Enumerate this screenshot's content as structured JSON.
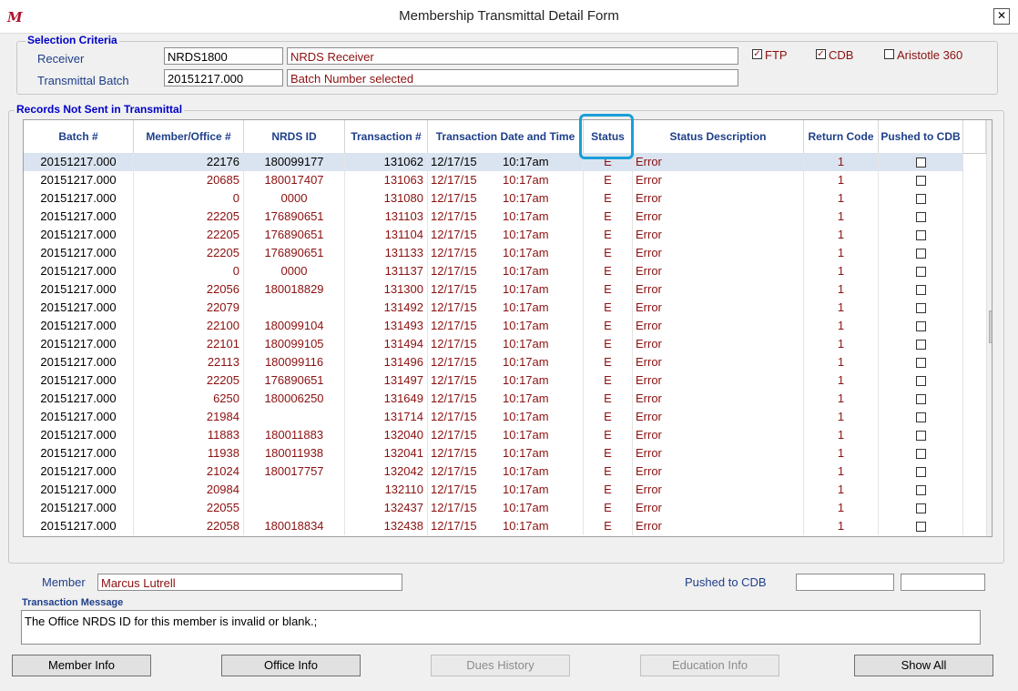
{
  "window": {
    "title": "Membership Transmittal Detail Form",
    "close_label": "✕"
  },
  "selection": {
    "label": "Selection Criteria",
    "receiver_label": "Receiver",
    "receiver_code": "NRDS1800",
    "receiver_name": "NRDS Receiver",
    "batch_label": "Transmittal Batch",
    "batch_value": "20151217.000",
    "batch_desc": "Batch Number selected",
    "ftp_label": "FTP",
    "ftp_checked": true,
    "cdb_label": "CDB",
    "cdb_checked": true,
    "aristotle_label": "Aristotle 360",
    "aristotle_checked": false
  },
  "records": {
    "label": "Records Not Sent in Transmittal",
    "columns": [
      "Batch #",
      "Member/Office #",
      "NRDS ID",
      "Transaction #",
      "Transaction Date and Time",
      "Status",
      "Status Description",
      "Return Code",
      "Pushed to CDB"
    ],
    "rows": [
      [
        "20151217.000",
        "22176",
        "180099177",
        "131062",
        "12/17/15",
        "10:17am",
        "E",
        "Error",
        "1"
      ],
      [
        "20151217.000",
        "20685",
        "180017407",
        "131063",
        "12/17/15",
        "10:17am",
        "E",
        "Error",
        "1"
      ],
      [
        "20151217.000",
        "0",
        "0000",
        "131080",
        "12/17/15",
        "10:17am",
        "E",
        "Error",
        "1"
      ],
      [
        "20151217.000",
        "22205",
        "176890651",
        "131103",
        "12/17/15",
        "10:17am",
        "E",
        "Error",
        "1"
      ],
      [
        "20151217.000",
        "22205",
        "176890651",
        "131104",
        "12/17/15",
        "10:17am",
        "E",
        "Error",
        "1"
      ],
      [
        "20151217.000",
        "22205",
        "176890651",
        "131133",
        "12/17/15",
        "10:17am",
        "E",
        "Error",
        "1"
      ],
      [
        "20151217.000",
        "0",
        "0000",
        "131137",
        "12/17/15",
        "10:17am",
        "E",
        "Error",
        "1"
      ],
      [
        "20151217.000",
        "22056",
        "180018829",
        "131300",
        "12/17/15",
        "10:17am",
        "E",
        "Error",
        "1"
      ],
      [
        "20151217.000",
        "22079",
        "",
        "131492",
        "12/17/15",
        "10:17am",
        "E",
        "Error",
        "1"
      ],
      [
        "20151217.000",
        "22100",
        "180099104",
        "131493",
        "12/17/15",
        "10:17am",
        "E",
        "Error",
        "1"
      ],
      [
        "20151217.000",
        "22101",
        "180099105",
        "131494",
        "12/17/15",
        "10:17am",
        "E",
        "Error",
        "1"
      ],
      [
        "20151217.000",
        "22113",
        "180099116",
        "131496",
        "12/17/15",
        "10:17am",
        "E",
        "Error",
        "1"
      ],
      [
        "20151217.000",
        "22205",
        "176890651",
        "131497",
        "12/17/15",
        "10:17am",
        "E",
        "Error",
        "1"
      ],
      [
        "20151217.000",
        "6250",
        "180006250",
        "131649",
        "12/17/15",
        "10:17am",
        "E",
        "Error",
        "1"
      ],
      [
        "20151217.000",
        "21984",
        "",
        "131714",
        "12/17/15",
        "10:17am",
        "E",
        "Error",
        "1"
      ],
      [
        "20151217.000",
        "11883",
        "180011883",
        "132040",
        "12/17/15",
        "10:17am",
        "E",
        "Error",
        "1"
      ],
      [
        "20151217.000",
        "11938",
        "180011938",
        "132041",
        "12/17/15",
        "10:17am",
        "E",
        "Error",
        "1"
      ],
      [
        "20151217.000",
        "21024",
        "180017757",
        "132042",
        "12/17/15",
        "10:17am",
        "E",
        "Error",
        "1"
      ],
      [
        "20151217.000",
        "20984",
        "",
        "132110",
        "12/17/15",
        "10:17am",
        "E",
        "Error",
        "1"
      ],
      [
        "20151217.000",
        "22055",
        "",
        "132437",
        "12/17/15",
        "10:17am",
        "E",
        "Error",
        "1"
      ],
      [
        "20151217.000",
        "22058",
        "180018834",
        "132438",
        "12/17/15",
        "10:17am",
        "E",
        "Error",
        "1"
      ]
    ]
  },
  "member": {
    "label": "Member",
    "value": "Marcus Lutrell",
    "pushed_label": "Pushed to CDB",
    "pushed_value1": "",
    "pushed_value2": ""
  },
  "message": {
    "label": "Transaction Message",
    "text": "The Office NRDS ID for this member is invalid or blank.;"
  },
  "buttons": {
    "member_info": "Member Info",
    "office_info": "Office Info",
    "dues_history": "Dues History",
    "education_info": "Education Info",
    "show_all": "Show All"
  },
  "colors": {
    "highlight": "#1a9fd8",
    "label_blue": "#1e3f8a",
    "value_red": "#8b1010"
  },
  "icons": {
    "app": "app-logo-icon",
    "close": "close-icon",
    "scroll_up": "chevron-up-icon",
    "scroll_down": "chevron-down-icon"
  }
}
